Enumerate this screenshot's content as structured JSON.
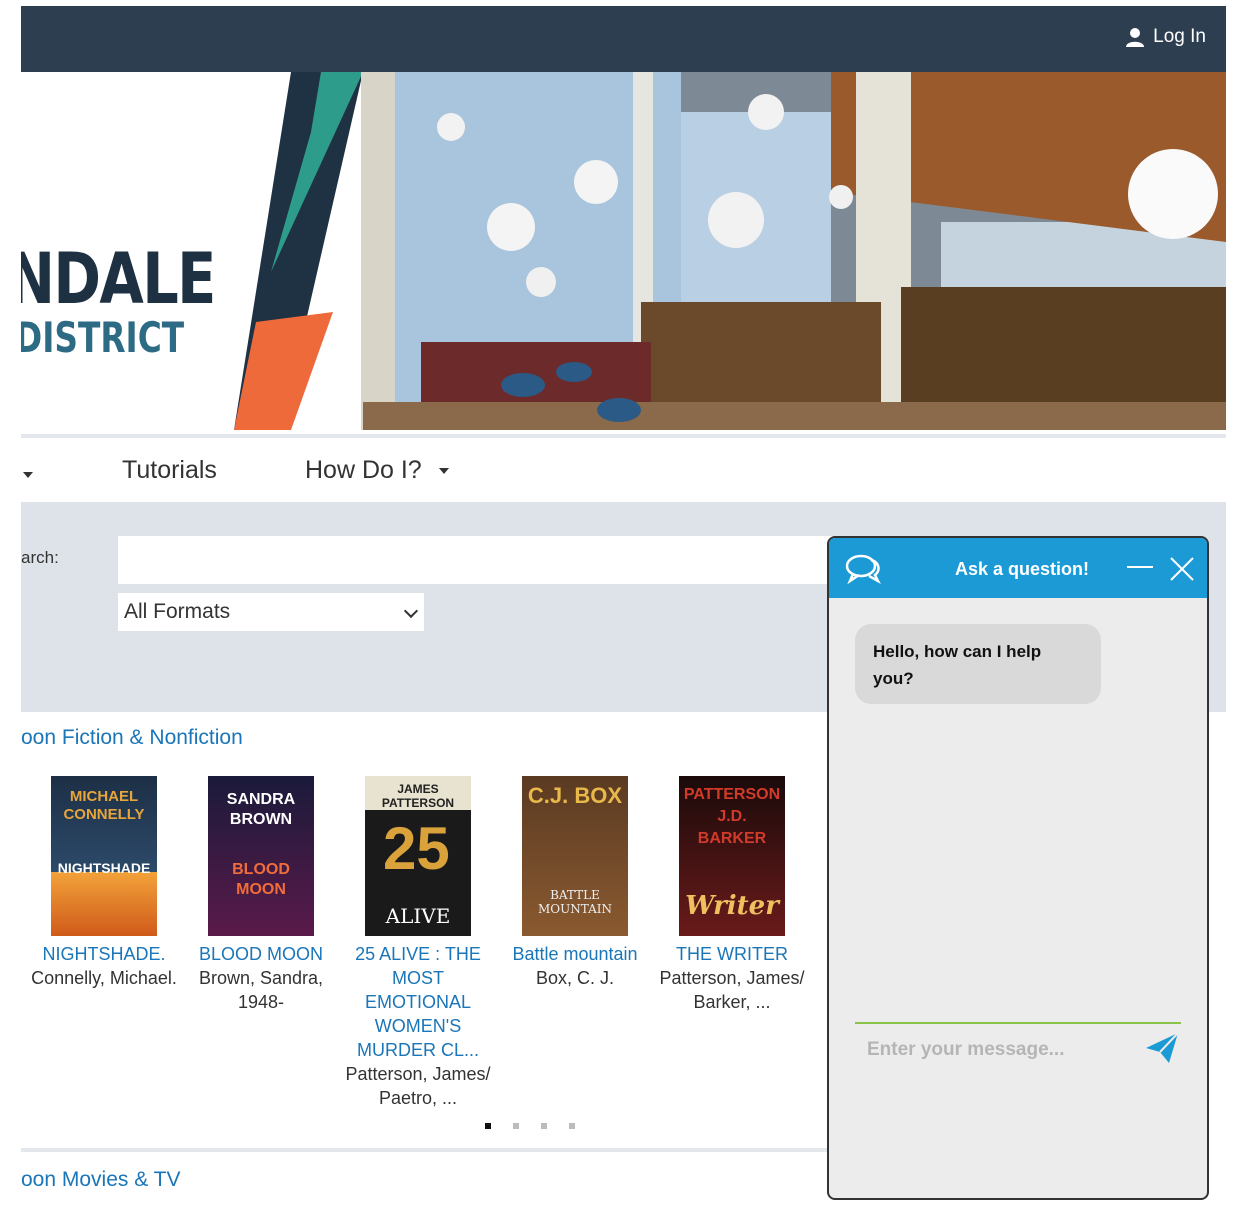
{
  "header": {
    "login_label": "Log In"
  },
  "banner": {
    "logo_line1": "NDALE",
    "logo_line2": "DISTRICT"
  },
  "nav": {
    "items": [
      {
        "label": "Tutorials"
      },
      {
        "label": "How Do I?"
      }
    ]
  },
  "search": {
    "label": "arch:",
    "value": "",
    "format_selected": "All Formats"
  },
  "sections": [
    {
      "title": "oon Fiction & Nonfiction"
    },
    {
      "title": "oon Movies & TV"
    }
  ],
  "books": [
    {
      "title": "NIGHTSHADE.",
      "author": "Connelly, Michael.",
      "cover_top": "MICHAEL CONNELLY",
      "cover_bottom": "NIGHTSHADE",
      "colors": [
        "#1d2f45",
        "#e8a53a"
      ]
    },
    {
      "title": "BLOOD MOON",
      "author": "Brown, Sandra, 1948-",
      "cover_top": "SANDRA BROWN",
      "cover_bottom": "BLOOD MOON",
      "colors": [
        "#1a1a3a",
        "#f06d3a"
      ]
    },
    {
      "title": "25 ALIVE : THE MOST EMOTIONAL WOMEN'S MURDER CL...",
      "author": "Patterson, James/ Paetro, ...",
      "cover_top": "JAMES PATTERSON",
      "cover_bottom": "ALIVE",
      "colors": [
        "#1a1a1a",
        "#d9a23a"
      ]
    },
    {
      "title": "Battle mountain",
      "author": "Box, C. J.",
      "cover_top": "C.J. BOX",
      "cover_bottom": "BATTLE MOUNTAIN",
      "colors": [
        "#7a4a2a",
        "#e8b84a"
      ]
    },
    {
      "title": "THE WRITER",
      "author": "Patterson, James/ Barker, ...",
      "cover_top": "PATTERSON J.D. BARKER",
      "cover_bottom": "Writer",
      "colors": [
        "#1a0a0a",
        "#d23a2a"
      ]
    }
  ],
  "chat": {
    "title": "Ask a question!",
    "greeting": "Hello, how can I help you?",
    "placeholder": "Enter your message..."
  }
}
